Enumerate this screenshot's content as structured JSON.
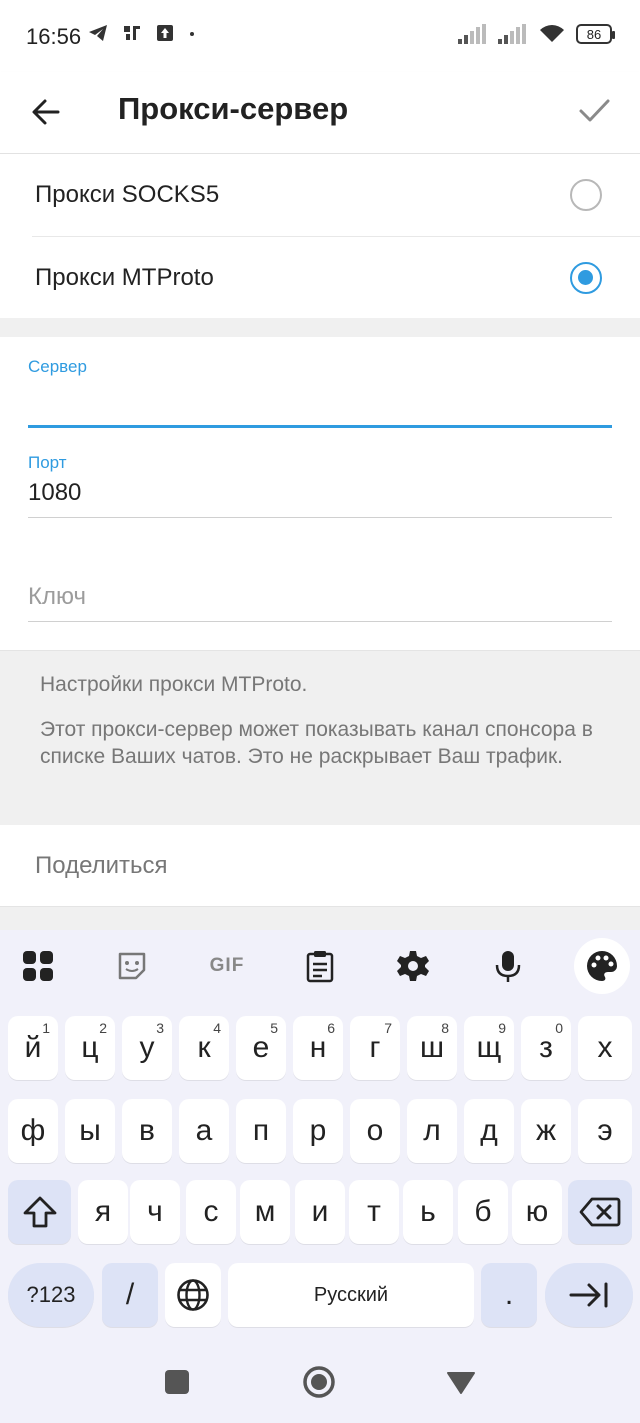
{
  "status": {
    "time": "16:56",
    "battery": "86"
  },
  "app_bar": {
    "title": "Прокси-сервер"
  },
  "proxy_types": [
    {
      "label": "Прокси SOCKS5",
      "selected": false
    },
    {
      "label": "Прокси MTProto",
      "selected": true
    }
  ],
  "fields": {
    "server": {
      "label": "Сервер",
      "value": ""
    },
    "port": {
      "label": "Порт",
      "value": "1080"
    },
    "key": {
      "placeholder": "Ключ",
      "value": ""
    }
  },
  "info": {
    "line1": "Настройки прокси MTProto.",
    "line2": "Этот прокси-сервер может показывать канал спонсора в списке Ваших чатов. Это не раскрывает Ваш трафик."
  },
  "share": {
    "label": "Поделиться"
  },
  "keyboard": {
    "toolbar": [
      "apps-icon",
      "sticker-icon",
      "gif-icon",
      "clipboard-icon",
      "settings-icon",
      "mic-icon",
      "palette-icon"
    ],
    "gif_label": "GIF",
    "row1": [
      {
        "k": "й",
        "h": "1"
      },
      {
        "k": "ц",
        "h": "2"
      },
      {
        "k": "у",
        "h": "3"
      },
      {
        "k": "к",
        "h": "4"
      },
      {
        "k": "е",
        "h": "5"
      },
      {
        "k": "н",
        "h": "6"
      },
      {
        "k": "г",
        "h": "7"
      },
      {
        "k": "ш",
        "h": "8"
      },
      {
        "k": "щ",
        "h": "9"
      },
      {
        "k": "з",
        "h": "0"
      },
      {
        "k": "х",
        "h": ""
      }
    ],
    "row2": [
      "ф",
      "ы",
      "в",
      "а",
      "п",
      "р",
      "о",
      "л",
      "д",
      "ж",
      "э"
    ],
    "row3": [
      "я",
      "ч",
      "с",
      "м",
      "и",
      "т",
      "ь",
      "б",
      "ю"
    ],
    "symbols_label": "?123",
    "slash_label": "/",
    "space_label": "Русский",
    "period_label": "."
  },
  "colors": {
    "accent": "#2f9be0",
    "keyboard_bg": "#f1f1fa",
    "mod_key": "#dde3f6"
  }
}
